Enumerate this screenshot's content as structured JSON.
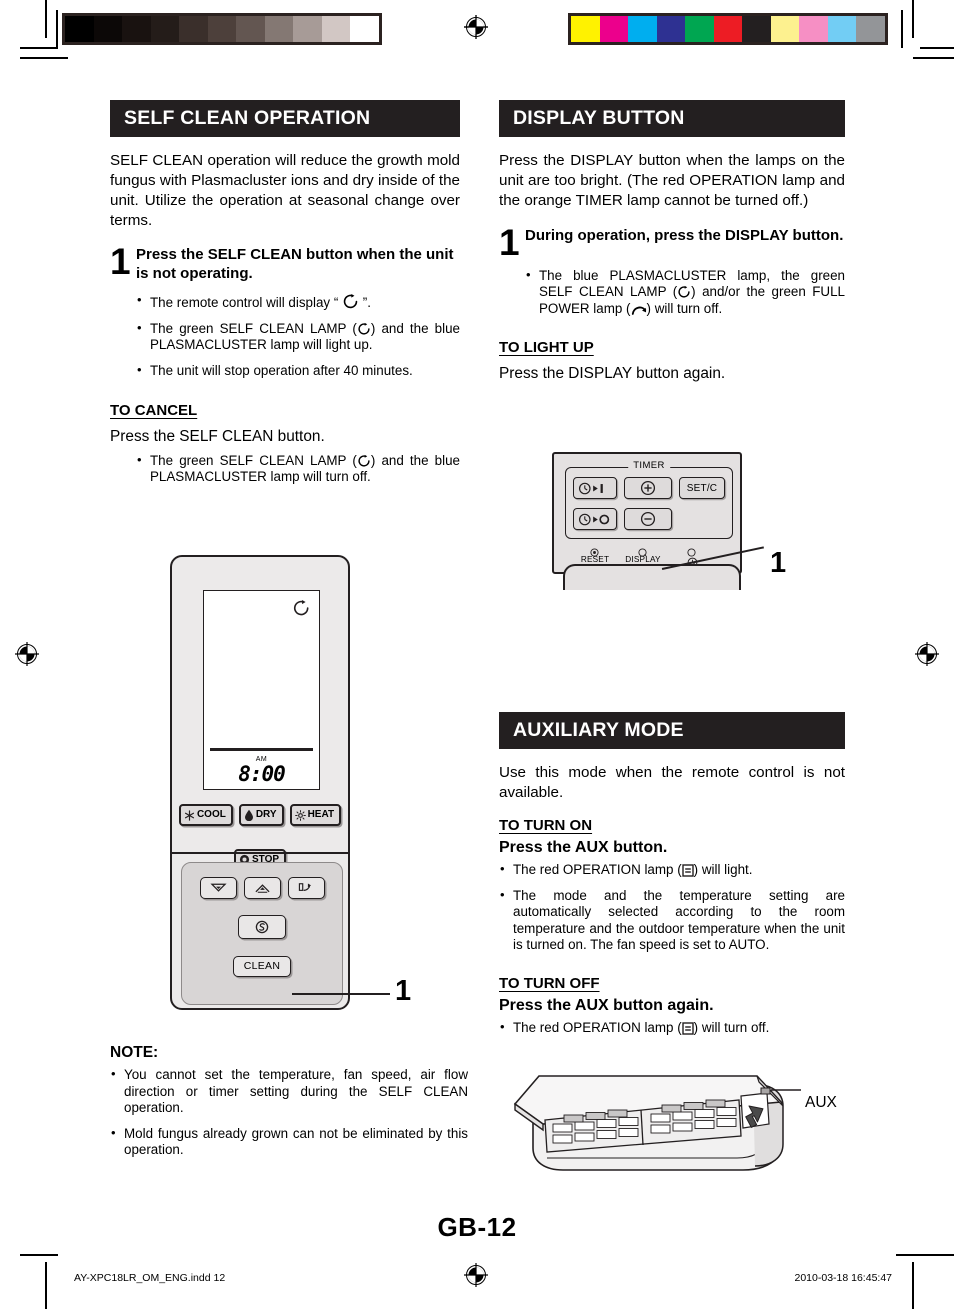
{
  "print_marks": {
    "grayscale_swatches": [
      "#000000",
      "#0c0807",
      "#191210",
      "#241c19",
      "#3a2f2b",
      "#4d403b",
      "#635651",
      "#847873",
      "#a79b97",
      "#d2c7c4",
      "#ffffff"
    ],
    "color_swatches": [
      "#fff200",
      "#ec008c",
      "#00aeef",
      "#2e3192",
      "#00a651",
      "#ed1c24",
      "#231f20",
      "#fdf18f",
      "#f68fc4",
      "#72cdf4",
      "#939598"
    ]
  },
  "left_column": {
    "section_title": "SELF CLEAN OPERATION",
    "intro": "SELF CLEAN operation will reduce the growth mold fungus with Plasmacluster ions and dry inside of the unit. Utilize the operation at seasonal change over terms.",
    "step": {
      "number": "1",
      "text": "Press the SELF CLEAN button when the unit is not operating."
    },
    "bullets": [
      "The remote control will display “ ”.",
      "The green SELF CLEAN LAMP ( ) and the blue PLASMACLUSTER lamp will light up.",
      "The unit will stop operation after 40 minutes."
    ],
    "cancel_head": "TO CANCEL",
    "cancel_line": "Press the SELF CLEAN button.",
    "cancel_bullet": "The green SELF CLEAN LAMP ( ) and the blue PLASMACLUSTER lamp will turn off.",
    "note": {
      "head": "NOTE:",
      "items": [
        "You cannot set the temperature, fan speed, air flow direction or timer setting during the SELF CLEAN operation.",
        "Mold fungus already grown can not be eliminated by this operation."
      ]
    },
    "remote_figure": {
      "lcd_time": "8:00",
      "lcd_ampm": "AM",
      "mode_buttons": [
        "COOL",
        "DRY",
        "HEAT"
      ],
      "stop_button": "STOP",
      "clean_button": "CLEAN",
      "callout": "1"
    }
  },
  "right_column": {
    "display_section": {
      "section_title": "DISPLAY BUTTON",
      "intro": "Press the DISPLAY button when the lamps on the unit are too bright. (The red OPERATION lamp and the orange TIMER lamp cannot be turned off.)",
      "step": {
        "number": "1",
        "text": "During operation, press the DISPLAY button."
      },
      "bullet": "The blue PLASMACLUSTER lamp, the green SELF CLEAN LAMP ( ) and/or the green FULL POWER lamp ( ) will turn off.",
      "light_up_head": "TO LIGHT UP",
      "light_up_line": "Press the DISPLAY button again.",
      "timer_figure": {
        "group_legend": "TIMER",
        "setc_button": "SET/C",
        "reset_label": "RESET",
        "display_label": "DISPLAY",
        "callout": "1"
      }
    },
    "auxiliary_section": {
      "section_title": "AUXILIARY MODE",
      "intro": "Use this mode when the remote control is not available.",
      "turn_on_head": "TO TURN ON",
      "turn_on_line": "Press the AUX button.",
      "turn_on_bullets": [
        "The red OPERATION lamp ( ) will light.",
        "The mode and the temperature setting are automatically selected according to the room temperature and the outdoor temperature when the unit is turned on. The fan speed is set to AUTO."
      ],
      "turn_off_head": "TO TURN OFF",
      "turn_off_line": "Press the AUX button again.",
      "turn_off_bullet": "The red OPERATION lamp ( ) will turn off.",
      "unit_figure": {
        "aux_label": "AUX"
      }
    }
  },
  "footer": {
    "page_number": "GB-12",
    "file_info": "AY-XPC18LR_OM_ENG.indd   12",
    "timestamp": "2010-03-18   16:45:47"
  }
}
